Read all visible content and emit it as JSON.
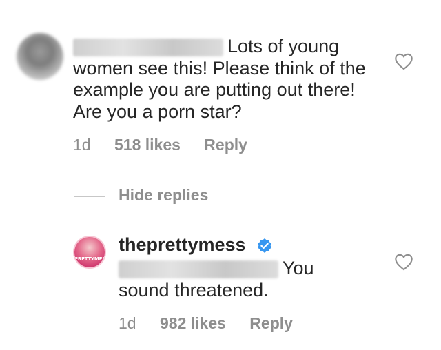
{
  "comment": {
    "text": "Lots of young women see this! Please think of the example you are putting out there! Are you a porn star?",
    "time": "1d",
    "likes": "518 likes",
    "reply_label": "Reply"
  },
  "hide_replies_label": "Hide replies",
  "reply": {
    "username": "theprettymess",
    "avatar_text": "PRETTYMESS",
    "text": "You sound threatened.",
    "time": "1d",
    "likes": "982 likes",
    "reply_label": "Reply"
  },
  "colors": {
    "text": "#262626",
    "muted": "#8e8e8e",
    "verified": "#3897f0"
  },
  "icons": [
    "heart-icon",
    "verified-badge-icon"
  ]
}
